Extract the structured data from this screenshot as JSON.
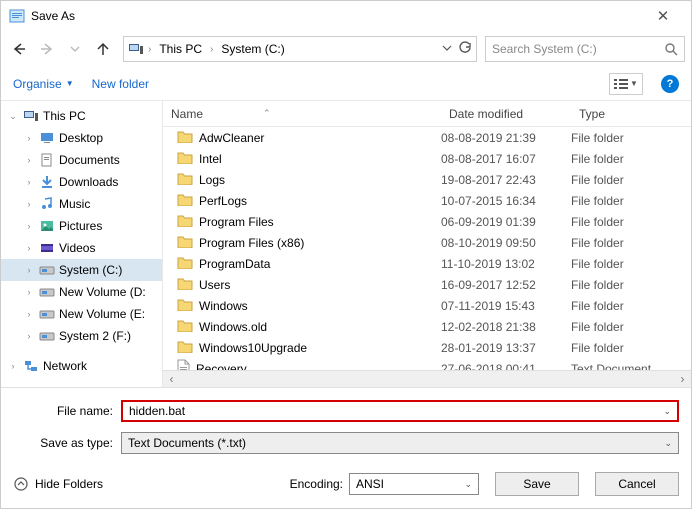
{
  "window": {
    "title": "Save As",
    "close": "✕"
  },
  "nav": {
    "breadcrumb": [
      "This PC",
      "System (C:)"
    ],
    "search_placeholder": "Search System (C:)"
  },
  "toolbar": {
    "organise": "Organise",
    "new_folder": "New folder"
  },
  "tree": {
    "root": "This PC",
    "children": [
      "Desktop",
      "Documents",
      "Downloads",
      "Music",
      "Pictures",
      "Videos",
      "System (C:)",
      "New Volume (D:",
      "New Volume (E:",
      "System 2 (F:)"
    ],
    "network": "Network",
    "selected": "System (C:)"
  },
  "columns": {
    "name": "Name",
    "date": "Date modified",
    "type": "Type"
  },
  "files": [
    {
      "name": "AdwCleaner",
      "date": "08-08-2019 21:39",
      "type": "File folder",
      "kind": "folder"
    },
    {
      "name": "Intel",
      "date": "08-08-2017 16:07",
      "type": "File folder",
      "kind": "folder"
    },
    {
      "name": "Logs",
      "date": "19-08-2017 22:43",
      "type": "File folder",
      "kind": "folder"
    },
    {
      "name": "PerfLogs",
      "date": "10-07-2015 16:34",
      "type": "File folder",
      "kind": "folder"
    },
    {
      "name": "Program Files",
      "date": "06-09-2019 01:39",
      "type": "File folder",
      "kind": "folder"
    },
    {
      "name": "Program Files (x86)",
      "date": "08-10-2019 09:50",
      "type": "File folder",
      "kind": "folder"
    },
    {
      "name": "ProgramData",
      "date": "11-10-2019 13:02",
      "type": "File folder",
      "kind": "folder"
    },
    {
      "name": "Users",
      "date": "16-09-2017 12:52",
      "type": "File folder",
      "kind": "folder"
    },
    {
      "name": "Windows",
      "date": "07-11-2019 15:43",
      "type": "File folder",
      "kind": "folder"
    },
    {
      "name": "Windows.old",
      "date": "12-02-2018 21:38",
      "type": "File folder",
      "kind": "folder"
    },
    {
      "name": "Windows10Upgrade",
      "date": "28-01-2019 13:37",
      "type": "File folder",
      "kind": "folder"
    },
    {
      "name": "Recovery",
      "date": "27-06-2018 00:41",
      "type": "Text Document",
      "kind": "doc"
    }
  ],
  "form": {
    "filename_label": "File name:",
    "filename_value": "hidden.bat",
    "type_label": "Save as type:",
    "type_value": "Text Documents (*.txt)"
  },
  "actions": {
    "hide_folders": "Hide Folders",
    "encoding_label": "Encoding:",
    "encoding_value": "ANSI",
    "save": "Save",
    "cancel": "Cancel"
  }
}
